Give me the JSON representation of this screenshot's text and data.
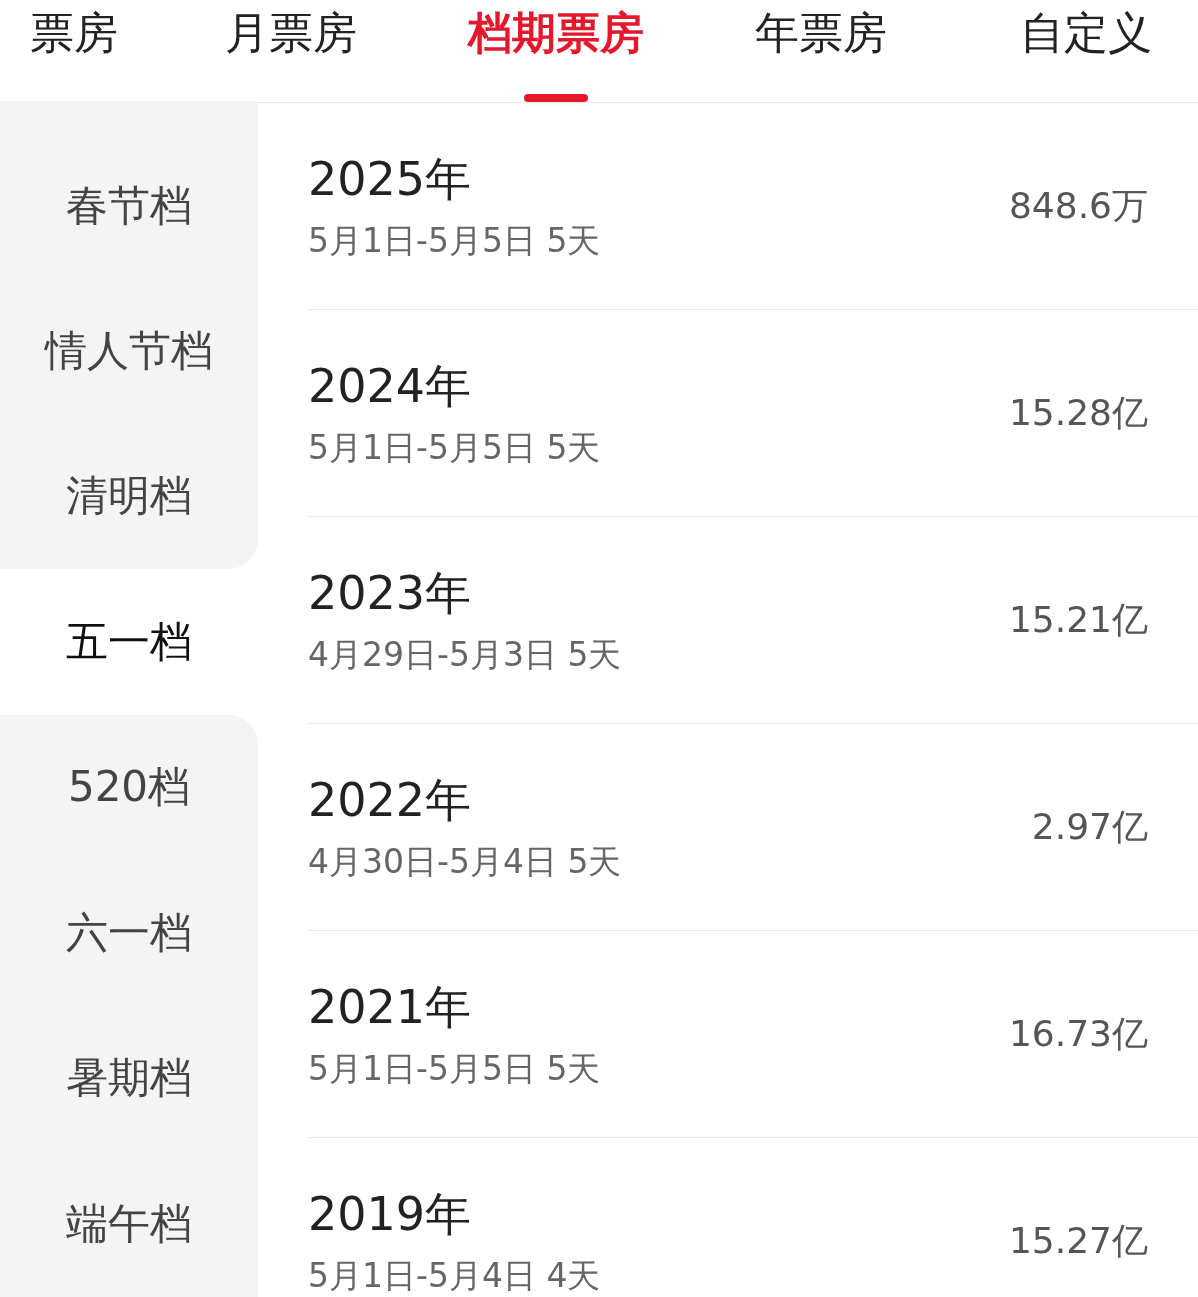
{
  "tabs": [
    {
      "label": "票房",
      "selected": false
    },
    {
      "label": "月票房",
      "selected": false
    },
    {
      "label": "档期票房",
      "selected": true
    },
    {
      "label": "年票房",
      "selected": false
    },
    {
      "label": "自定义",
      "selected": false
    }
  ],
  "sidebar": {
    "items": [
      {
        "label": "春节档",
        "selected": false
      },
      {
        "label": "情人节档",
        "selected": false
      },
      {
        "label": "清明档",
        "selected": false
      },
      {
        "label": "五一档",
        "selected": true
      },
      {
        "label": "520档",
        "selected": false
      },
      {
        "label": "六一档",
        "selected": false
      },
      {
        "label": "暑期档",
        "selected": false
      },
      {
        "label": "端午档",
        "selected": false
      }
    ]
  },
  "rows": [
    {
      "year": "2025年",
      "dates": "5月1日-5月5日 5天",
      "box_office": "848.6万"
    },
    {
      "year": "2024年",
      "dates": "5月1日-5月5日 5天",
      "box_office": "15.28亿"
    },
    {
      "year": "2023年",
      "dates": "4月29日-5月3日 5天",
      "box_office": "15.21亿"
    },
    {
      "year": "2022年",
      "dates": "4月30日-5月4日 5天",
      "box_office": "2.97亿"
    },
    {
      "year": "2021年",
      "dates": "5月1日-5月5日 5天",
      "box_office": "16.73亿"
    },
    {
      "year": "2019年",
      "dates": "5月1日-5月4日 4天",
      "box_office": "15.27亿"
    }
  ]
}
